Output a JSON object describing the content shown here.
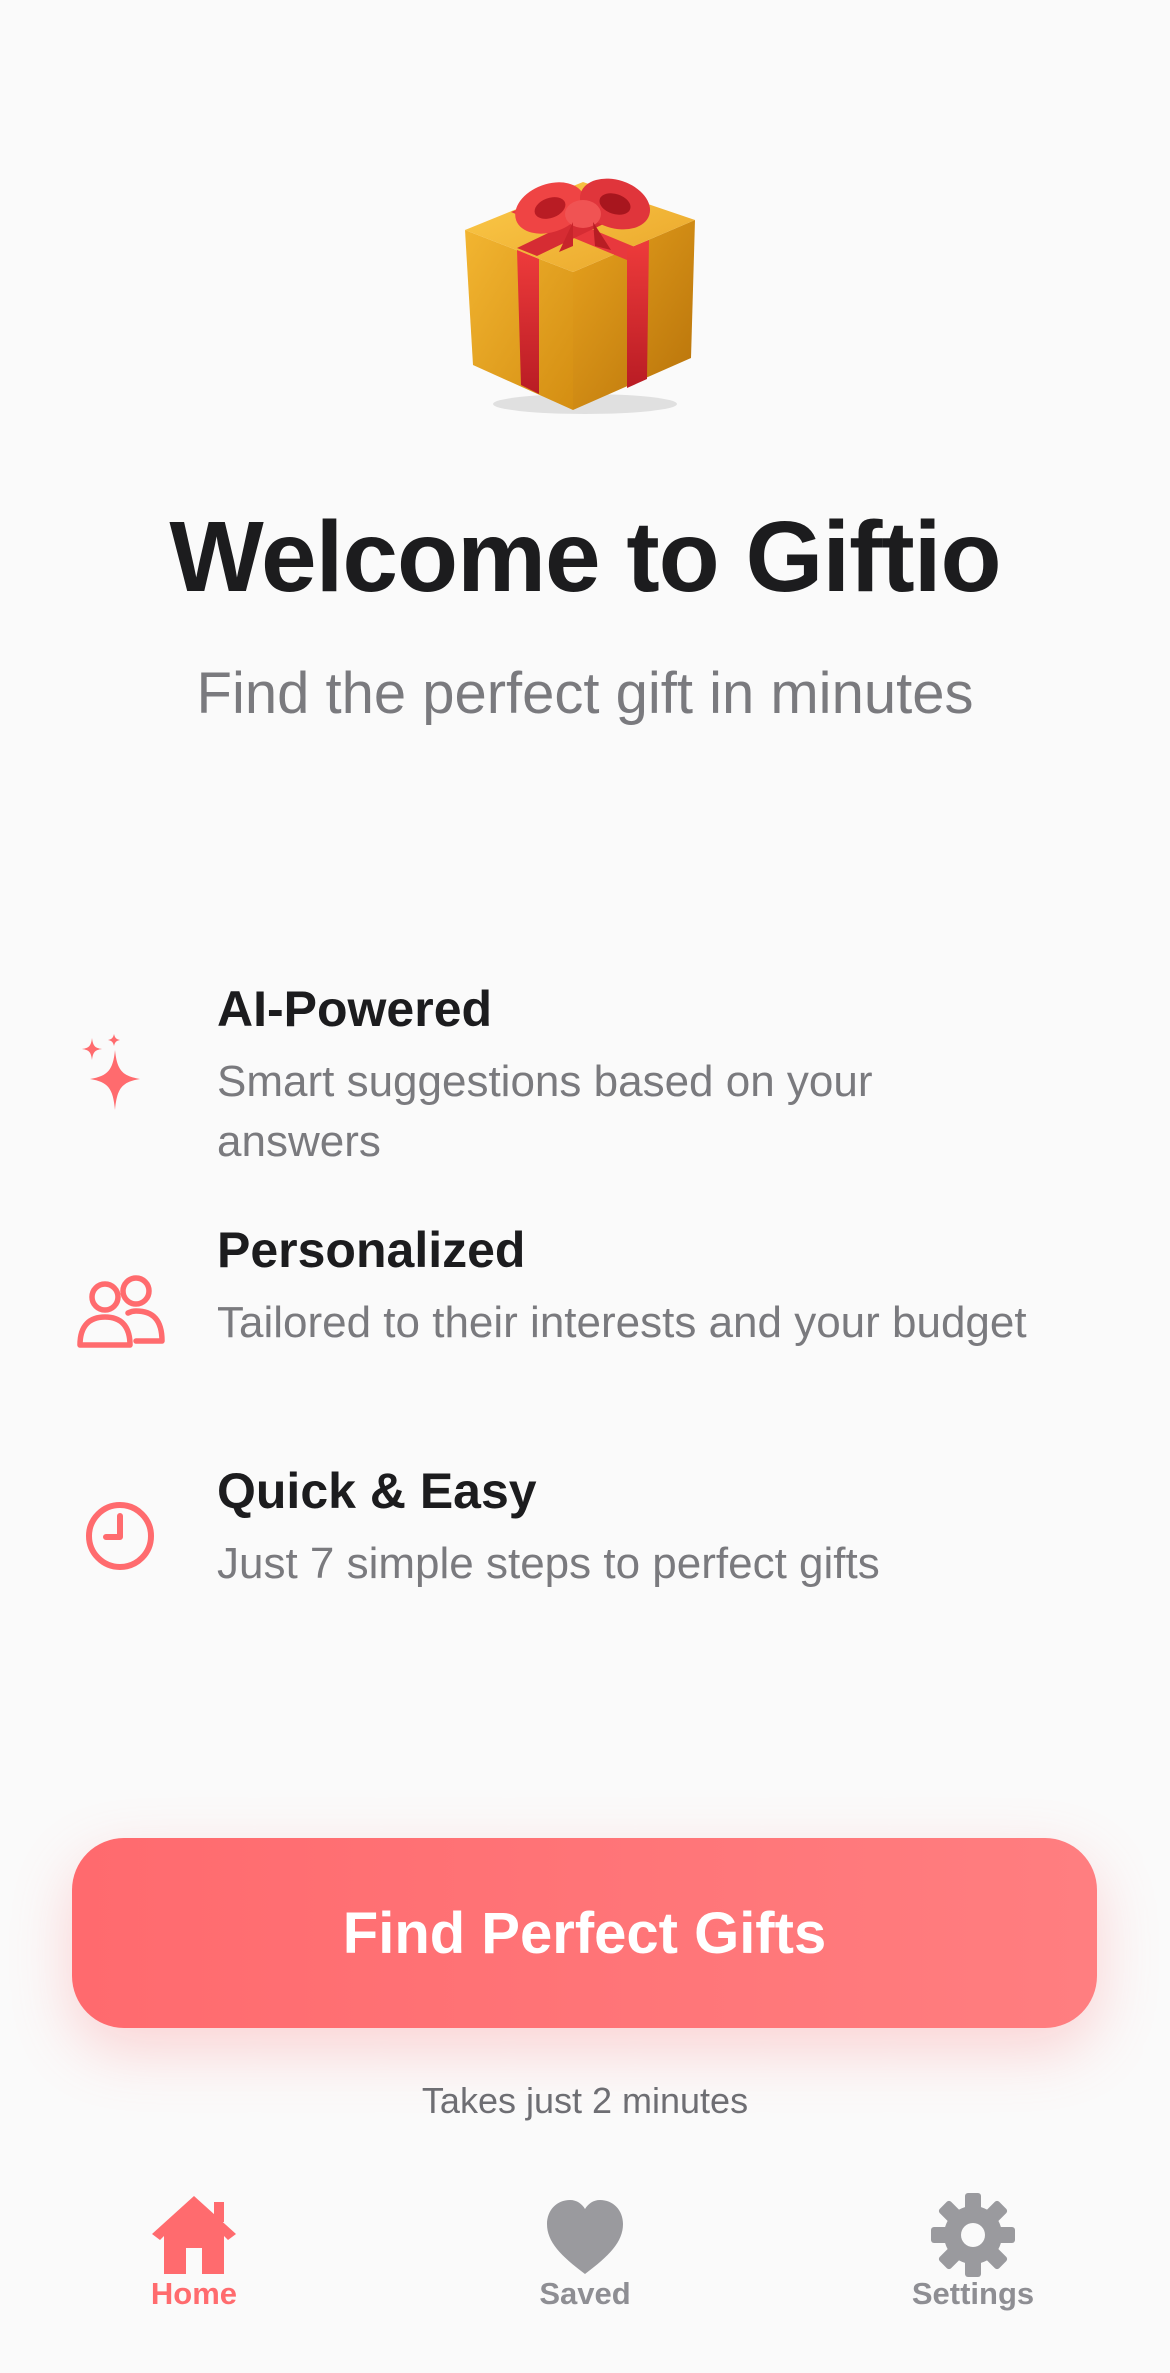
{
  "hero": {
    "icon": "gift-icon",
    "title": "Welcome to Giftio",
    "subtitle": "Find the perfect gift in minutes"
  },
  "features": [
    {
      "icon": "sparkles-icon",
      "title": "AI-Powered",
      "description": "Smart suggestions based on your answers"
    },
    {
      "icon": "people-icon",
      "title": "Personalized",
      "description": "Tailored to their interests and your budget"
    },
    {
      "icon": "clock-icon",
      "title": "Quick & Easy",
      "description": "Just 7 simple steps to perfect gifts"
    }
  ],
  "cta": {
    "label": "Find Perfect Gifts",
    "note": "Takes just 2 minutes"
  },
  "tabs": [
    {
      "label": "Home",
      "icon": "house-icon",
      "selected": true
    },
    {
      "label": "Saved",
      "icon": "heart-icon",
      "selected": false
    },
    {
      "label": "Settings",
      "icon": "gear-icon",
      "selected": false
    }
  ],
  "colors": {
    "accent": "#FF6B6E",
    "title": "#1C1C1E",
    "secondary_text": "#7A7A7E",
    "tab_inactive": "#9A9A9E",
    "background": "#FAFAFA"
  }
}
